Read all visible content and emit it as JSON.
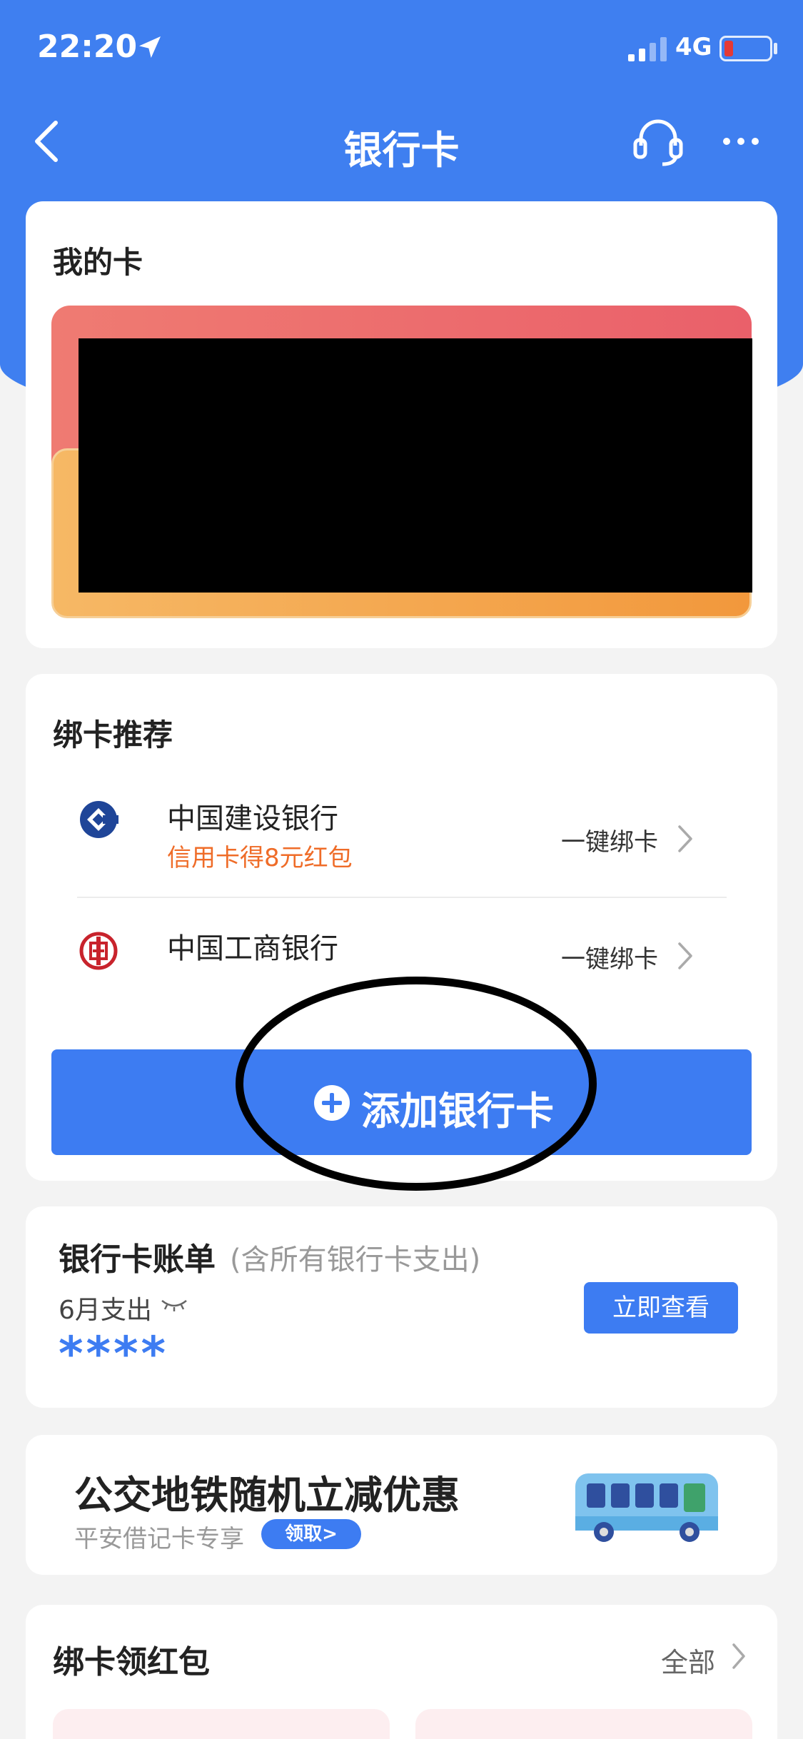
{
  "status_bar": {
    "time": "22:20",
    "network": "4G"
  },
  "nav": {
    "title": "银行卡"
  },
  "my_cards": {
    "title": "我的卡"
  },
  "recommend": {
    "title": "绑卡推荐",
    "banks": [
      {
        "name": "中国建设银行",
        "promo": "信用卡得8元红包",
        "action": "一键绑卡",
        "icon": "ccb-logo-icon"
      },
      {
        "name": "中国工商银行",
        "promo": "",
        "action": "一键绑卡",
        "icon": "icbc-logo-icon"
      }
    ],
    "add_button": "添加银行卡"
  },
  "bill": {
    "title": "银行卡账单",
    "subtitle": "(含所有银行卡支出)",
    "month_label": "6月支出",
    "amount": "****",
    "button": "立即查看"
  },
  "promo": {
    "title": "公交地铁随机立减优惠",
    "subtitle": "平安借记卡专享",
    "tag": "领取>"
  },
  "red_packet": {
    "title": "绑卡领红包",
    "all_label": "全部"
  },
  "colors": {
    "primary": "#3d7cf2",
    "header": "#3f7ff0",
    "promo_orange": "#ef6c28"
  }
}
